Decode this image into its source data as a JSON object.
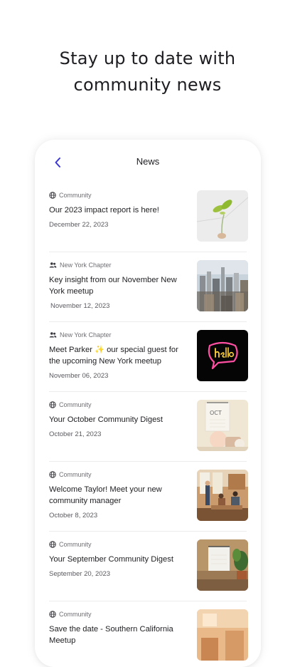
{
  "headline": {
    "line1": "Stay up to date with",
    "line2": "community news"
  },
  "screen": {
    "title": "News",
    "back_icon": "chevron-left-icon",
    "accent_color": "#3b36d6"
  },
  "news_items": [
    {
      "source": "Community",
      "source_icon": "globe-icon",
      "title": "Our 2023 impact report is here!",
      "date": "December 22, 2023",
      "thumbnail": "plant-sprout-image"
    },
    {
      "source": "New York Chapter",
      "source_icon": "people-icon",
      "title": "Key insight from our November New York meetup",
      "date": "November 12, 2023",
      "thumbnail": "city-skyline-image"
    },
    {
      "source": "New York Chapter",
      "source_icon": "people-icon",
      "title": "Meet Parker ✨ our special guest for the upcoming New York meetup",
      "date": "November 06, 2023",
      "thumbnail": "neon-hello-sign-image"
    },
    {
      "source": "Community",
      "source_icon": "globe-icon",
      "title": "Your October Community Digest",
      "date": "October 21, 2023",
      "thumbnail": "oct-calendar-image"
    },
    {
      "source": "Community",
      "source_icon": "globe-icon",
      "title": "Welcome Taylor! Meet your new community manager",
      "date": "October 8, 2023",
      "thumbnail": "office-meeting-image"
    },
    {
      "source": "Community",
      "source_icon": "globe-icon",
      "title": "Your September Community Digest",
      "date": "September 20, 2023",
      "thumbnail": "calendar-with-plant-image"
    },
    {
      "source": "Community",
      "source_icon": "globe-icon",
      "title": "Save the date - Southern California Meetup",
      "date": "",
      "thumbnail": "warm-interior-image"
    }
  ]
}
